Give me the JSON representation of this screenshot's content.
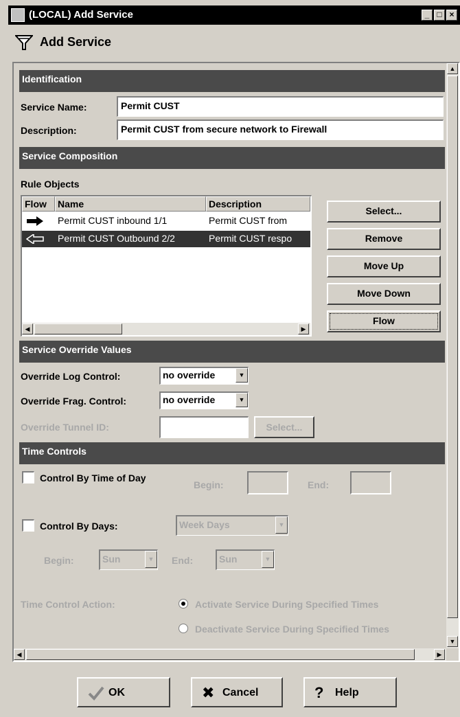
{
  "window": {
    "title": "(LOCAL) Add Service",
    "controls": [
      "_",
      "□",
      "×"
    ]
  },
  "header": {
    "title": "Add Service",
    "icon": "funnel-icon"
  },
  "identification": {
    "section_title": "Identification",
    "service_name_label": "Service Name:",
    "service_name_value": "Permit CUST",
    "description_label": "Description:",
    "description_value": "Permit CUST from secure network to Firewall"
  },
  "composition": {
    "section_title": "Service Composition",
    "rule_objects_label": "Rule Objects",
    "columns": [
      "Flow",
      "Name",
      "Description"
    ],
    "rows": [
      {
        "flow": "right-arrow-icon",
        "name": "Permit CUST inbound 1/1",
        "description": "Permit CUST from",
        "selected": false
      },
      {
        "flow": "left-arrow-icon",
        "name": "Permit CUST Outbound 2/2",
        "description": "Permit CUST respo",
        "selected": true
      }
    ],
    "buttons": {
      "select": "Select...",
      "remove": "Remove",
      "move_up": "Move Up",
      "move_down": "Move Down",
      "flow": "Flow"
    }
  },
  "override": {
    "section_title": "Service Override Values",
    "log_label": "Override Log Control:",
    "log_value": "no override",
    "frag_label": "Override Frag. Control:",
    "frag_value": "no override",
    "tunnel_label": "Override Tunnel ID:",
    "tunnel_value": "",
    "tunnel_select": "Select..."
  },
  "time": {
    "section_title": "Time Controls",
    "time_of_day_label": "Control By Time of Day",
    "tod_checked": false,
    "begin_label": "Begin:",
    "end_label": "End:",
    "days_label": "Control By Days:",
    "days_checked": false,
    "days_value": "Week Days",
    "day_begin_label": "Begin:",
    "day_begin_value": "Sun",
    "day_end_label": "End:",
    "day_end_value": "Sun",
    "action_label": "Time Control Action:",
    "activate_label": "Activate Service During Specified Times",
    "deactivate_label": "Deactivate Service During Specified Times",
    "selected_action": "activate"
  },
  "footer": {
    "ok": "OK",
    "cancel": "Cancel",
    "help": "Help"
  }
}
